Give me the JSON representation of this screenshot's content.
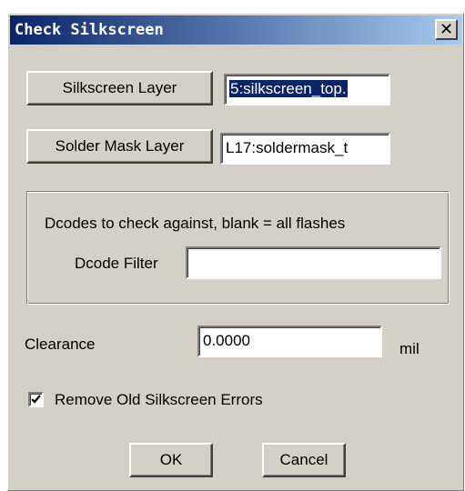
{
  "window": {
    "title": "Check Silkscreen",
    "close_glyph": "✕"
  },
  "silkscreen_layer": {
    "button_label": "Silkscreen Layer",
    "value": "5:silkscreen_top."
  },
  "soldermask_layer": {
    "button_label": "Solder Mask Layer",
    "value": "L17:soldermask_t"
  },
  "dcode_group": {
    "caption": "Dcodes to check against, blank = all flashes",
    "filter_label": "Dcode Filter",
    "filter_value": ""
  },
  "clearance": {
    "label": "Clearance",
    "value": "0.0000",
    "unit": "mil"
  },
  "remove_errors": {
    "label": "Remove Old Silkscreen Errors",
    "checked": true
  },
  "buttons": {
    "ok": "OK",
    "cancel": "Cancel"
  },
  "colors": {
    "dialog_bg": "#d4d0c8",
    "titlebar_start": "#0a246a",
    "titlebar_end": "#a6caf0",
    "selection": "#0a246a"
  }
}
